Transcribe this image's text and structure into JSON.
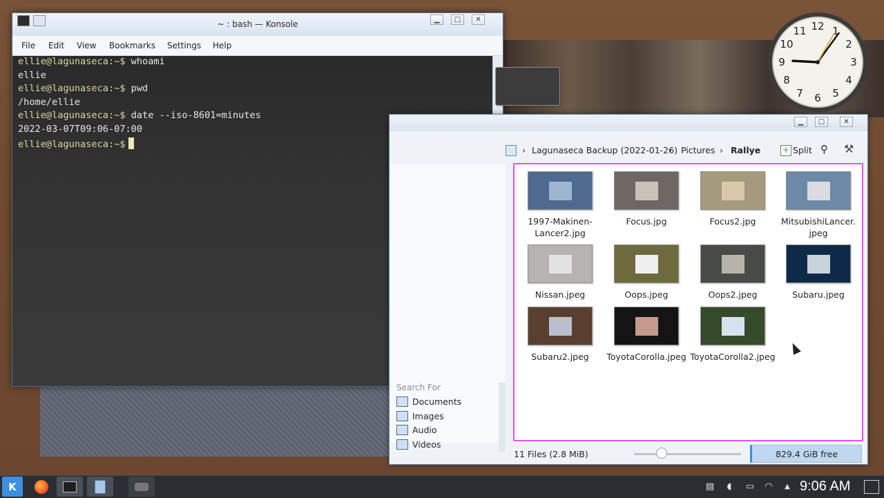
{
  "konsole": {
    "title": "~ : bash — Konsole",
    "menu": [
      "File",
      "Edit",
      "View",
      "Bookmarks",
      "Settings",
      "Help"
    ],
    "lines": [
      {
        "prompt": "ellie@lagunaseca:~$",
        "text": " whoami"
      },
      {
        "prompt": "",
        "text": "ellie"
      },
      {
        "prompt": "ellie@lagunaseca:~$",
        "text": " pwd"
      },
      {
        "prompt": "",
        "text": "/home/ellie"
      },
      {
        "prompt": "ellie@lagunaseca:~$",
        "text": " date --iso-8601=minutes"
      },
      {
        "prompt": "",
        "text": "2022-03-07T09:06-07:00"
      },
      {
        "prompt": "ellie@lagunaseca:~$",
        "text": ""
      }
    ]
  },
  "dolphin": {
    "breadcrumb": [
      "Lagunaseca Backup (2022-01-26)",
      "Pictures",
      "Rallye"
    ],
    "split_label": "Split",
    "places_header": "Search For",
    "places": [
      "Documents",
      "Images",
      "Audio",
      "Videos"
    ],
    "files": [
      {
        "name": "1997-Makinen-Lancer2.jpg",
        "lines": [
          "1997-Makinen-",
          "Lancer2.jpg"
        ],
        "bg": "#4f6a90",
        "pic": "#9db6cf"
      },
      {
        "name": "Focus.jpg",
        "lines": [
          "Focus.jpg"
        ],
        "bg": "#6f6763",
        "pic": "#c9c2ba"
      },
      {
        "name": "Focus2.jpg",
        "lines": [
          "Focus2.jpg"
        ],
        "bg": "#a69a7c",
        "pic": "#d8c7a8"
      },
      {
        "name": "MitsubishiLancer.jpeg",
        "lines": [
          "MitsubishiLancer.",
          "jpeg"
        ],
        "bg": "#6c8aa5",
        "pic": "#d9dde2"
      },
      {
        "name": "Nissan.jpeg",
        "lines": [
          "Nissan.jpeg"
        ],
        "bg": "#b7b3b3",
        "pic": "#e2e2e2"
      },
      {
        "name": "Oops.jpeg",
        "lines": [
          "Oops.jpeg"
        ],
        "bg": "#6d6a3e",
        "pic": "#efefef"
      },
      {
        "name": "Oops2.jpeg",
        "lines": [
          "Oops2.jpeg"
        ],
        "bg": "#474c46",
        "pic": "#b7b3aa"
      },
      {
        "name": "Subaru.jpeg",
        "lines": [
          "Subaru.jpeg"
        ],
        "bg": "#0f2a48",
        "pic": "#c8d3dc"
      },
      {
        "name": "Subaru2.jpeg",
        "lines": [
          "Subaru2.jpeg"
        ],
        "bg": "#5a3f30",
        "pic": "#b9c0cb"
      },
      {
        "name": "ToyotaCorolla.jpeg",
        "lines": [
          "ToyotaCorolla.jpeg"
        ],
        "bg": "#141414",
        "pic": "#c59a8c"
      },
      {
        "name": "ToyotaCorolla2.jpeg",
        "lines": [
          "ToyotaCorolla2.jpeg"
        ],
        "bg": "#364a2c",
        "pic": "#d7e2ef"
      }
    ],
    "status_text": "11 Files (2.8 MiB)",
    "free_space": "829.4 GiB free"
  },
  "clock_widget": {
    "numerals": [
      "12",
      "1",
      "2",
      "3",
      "4",
      "5",
      "6",
      "7",
      "8",
      "9",
      "10",
      "11"
    ],
    "hour": 9,
    "minute": 6
  },
  "taskbar": {
    "time": "9:06 AM"
  },
  "colors": {
    "accent": "#3d8ee0",
    "selection_border": "#e84ff0",
    "terminal_prompt": "#d9d9a0"
  }
}
